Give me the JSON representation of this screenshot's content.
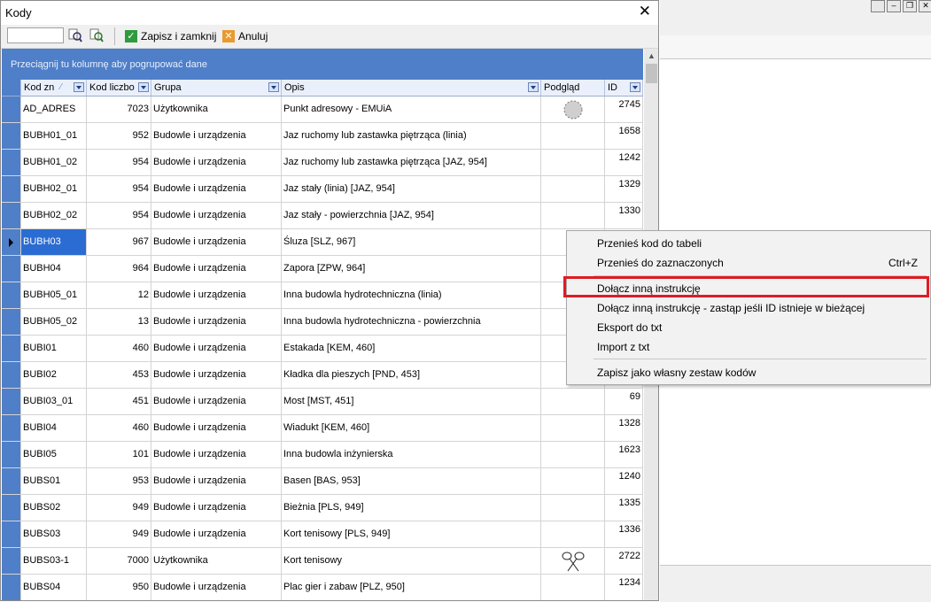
{
  "dialog": {
    "title": "Kody",
    "close_symbol": "✕",
    "toolbar": {
      "save_close_label": "Zapisz i zamknij",
      "cancel_label": "Anuluj",
      "search_value": ""
    }
  },
  "grid": {
    "group_hint": "Przeciągnij tu kolumnę aby pogrupować dane",
    "columns": [
      "Kod zn",
      "Kod liczbo",
      "Grupa",
      "Opis",
      "Podgląd",
      "ID"
    ],
    "rows": [
      {
        "kod": "AD_ADRES",
        "liczbo": "7023",
        "grupa": "Użytkownika",
        "opis": "Punkt adresowy - EMUiA",
        "id": "2745",
        "preview": "circle"
      },
      {
        "kod": "BUBH01_01",
        "liczbo": "952",
        "grupa": "Budowle i urządzenia",
        "opis": "Jaz ruchomy lub zastawka piętrząca (linia)",
        "id": "1658",
        "preview": ""
      },
      {
        "kod": "BUBH01_02",
        "liczbo": "954",
        "grupa": "Budowle i urządzenia",
        "opis": "Jaz ruchomy lub zastawka piętrząca [JAZ, 954]",
        "id": "1242",
        "preview": ""
      },
      {
        "kod": "BUBH02_01",
        "liczbo": "954",
        "grupa": "Budowle i urządzenia",
        "opis": "Jaz stały (linia) [JAZ, 954]",
        "id": "1329",
        "preview": ""
      },
      {
        "kod": "BUBH02_02",
        "liczbo": "954",
        "grupa": "Budowle i urządzenia",
        "opis": "Jaz stały - powierzchnia  [JAZ, 954]",
        "id": "1330",
        "preview": ""
      },
      {
        "kod": "BUBH03",
        "liczbo": "967",
        "grupa": "Budowle i urządzenia",
        "opis": "Śluza [SLZ, 967]",
        "id": "",
        "preview": ""
      },
      {
        "kod": "BUBH04",
        "liczbo": "964",
        "grupa": "Budowle i urządzenia",
        "opis": "Zapora [ZPW, 964]",
        "id": "",
        "preview": ""
      },
      {
        "kod": "BUBH05_01",
        "liczbo": "12",
        "grupa": "Budowle i urządzenia",
        "opis": "Inna budowla hydrotechniczna (linia)",
        "id": "",
        "preview": ""
      },
      {
        "kod": "BUBH05_02",
        "liczbo": "13",
        "grupa": "Budowle i urządzenia",
        "opis": "Inna budowla hydrotechniczna - powierzchnia",
        "id": "",
        "preview": ""
      },
      {
        "kod": "BUBI01",
        "liczbo": "460",
        "grupa": "Budowle i urządzenia",
        "opis": "Estakada [KEM, 460]",
        "id": "",
        "preview": ""
      },
      {
        "kod": "BUBI02",
        "liczbo": "453",
        "grupa": "Budowle i urządzenia",
        "opis": "Kładka dla pieszych [PND, 453]",
        "id": "",
        "preview": ""
      },
      {
        "kod": "BUBI03_01",
        "liczbo": "451",
        "grupa": "Budowle i urządzenia",
        "opis": "Most [MST, 451]",
        "id": "69",
        "preview": ""
      },
      {
        "kod": "BUBI04",
        "liczbo": "460",
        "grupa": "Budowle i urządzenia",
        "opis": "Wiadukt [KEM, 460]",
        "id": "1328",
        "preview": ""
      },
      {
        "kod": "BUBI05",
        "liczbo": "101",
        "grupa": "Budowle i urządzenia",
        "opis": "Inna budowla inżynierska",
        "id": "1623",
        "preview": ""
      },
      {
        "kod": "BUBS01",
        "liczbo": "953",
        "grupa": "Budowle i urządzenia",
        "opis": "Basen [BAS, 953]",
        "id": "1240",
        "preview": ""
      },
      {
        "kod": "BUBS02",
        "liczbo": "949",
        "grupa": "Budowle i urządzenia",
        "opis": "Bieżnia [PLS, 949]",
        "id": "1335",
        "preview": ""
      },
      {
        "kod": "BUBS03",
        "liczbo": "949",
        "grupa": "Budowle i urządzenia",
        "opis": "Kort tenisowy [PLS, 949]",
        "id": "1336",
        "preview": ""
      },
      {
        "kod": "BUBS03-1",
        "liczbo": "7000",
        "grupa": "Użytkownika",
        "opis": "Kort tenisowy",
        "id": "2722",
        "preview": "rackets"
      },
      {
        "kod": "BUBS04",
        "liczbo": "950",
        "grupa": "Budowle i urządzenia",
        "opis": "Plac gier i zabaw [PLZ, 950]",
        "id": "1234",
        "preview": ""
      }
    ],
    "selected_row": 5
  },
  "context_menu": {
    "items": [
      {
        "label": "Przenieś kod do tabeli",
        "shortcut": ""
      },
      {
        "label": "Przenieś do zaznaczonych",
        "shortcut": "Ctrl+Z"
      },
      {
        "label": "Dołącz inną instrukcję",
        "shortcut": ""
      },
      {
        "label": "Dołącz inną instrukcję - zastąp jeśli ID istnieje w bieżącej",
        "shortcut": ""
      },
      {
        "label": "Eksport do txt",
        "shortcut": ""
      },
      {
        "label": "Import z txt",
        "shortcut": ""
      },
      {
        "label": "Zapisz jako własny zestaw kodów",
        "shortcut": ""
      }
    ],
    "highlighted_index": 2,
    "highlight_color": "#e01b24"
  },
  "colors": {
    "grid_accent": "#4f7fc8",
    "selected_cell": "#2b6cd2"
  }
}
